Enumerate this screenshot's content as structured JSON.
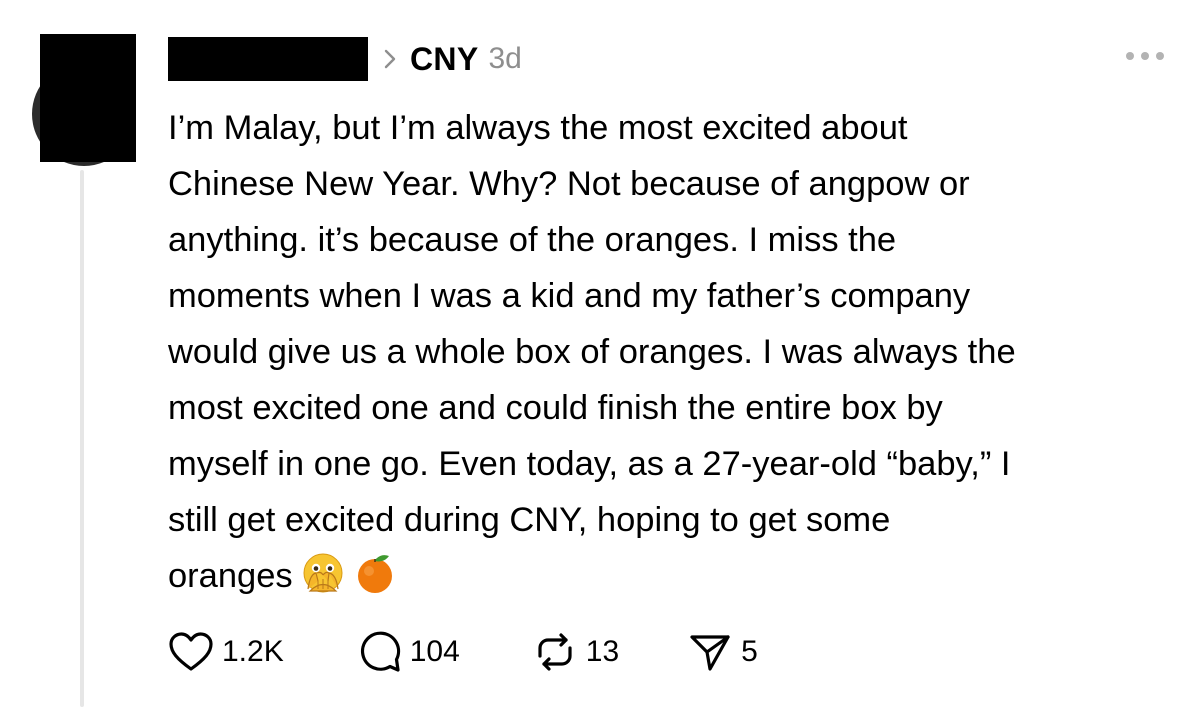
{
  "post": {
    "topic": "CNY",
    "time": "3d",
    "text_lines": [
      "I’m Malay, but I’m always the most excited about",
      "Chinese New Year. Why? Not because of angpow or",
      "anything. it’s because of the oranges. I miss the",
      "moments when I was a kid and my father’s company",
      "would give us a whole box of oranges. I was always the",
      "most excited one and could finish the entire box by",
      "myself in one go. Even today, as a 27-year-old “baby,” I",
      "still get excited during CNY, hoping to get some"
    ],
    "last_line": "oranges",
    "emojis": [
      "face-with-open-eyes-and-hand-over-mouth-icon",
      "tangerine-icon"
    ]
  },
  "actions": {
    "likes": "1.2K",
    "replies": "104",
    "reposts": "13",
    "shares": "5"
  },
  "icons": {
    "like": "heart-icon",
    "reply": "speech-bubble-icon",
    "repost": "repost-arrows-icon",
    "share": "send-arrow-icon",
    "more": "more-dots-icon",
    "separator": "chevron-right-icon"
  },
  "colors": {
    "text": "#000000",
    "muted": "#8e8e8e",
    "thread_line": "#e6e6e6",
    "orange": "#f07a0c"
  }
}
